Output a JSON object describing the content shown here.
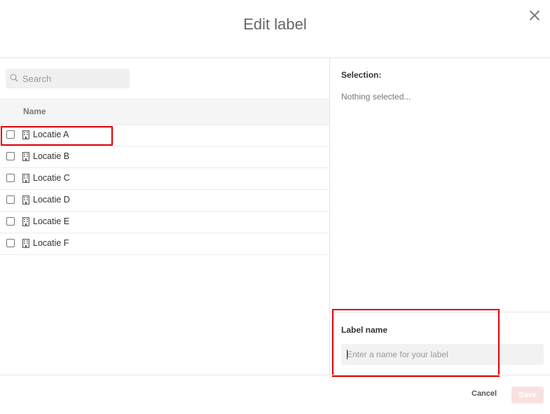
{
  "dialog": {
    "title": "Edit label"
  },
  "search": {
    "placeholder": "Search"
  },
  "table": {
    "header": "Name",
    "rows": [
      {
        "label": "Locatie A"
      },
      {
        "label": "Locatie B"
      },
      {
        "label": "Locatie C"
      },
      {
        "label": "Locatie D"
      },
      {
        "label": "Locatie E"
      },
      {
        "label": "Locatie F"
      }
    ]
  },
  "selection": {
    "title": "Selection:",
    "empty_text": "Nothing selected..."
  },
  "label_name": {
    "title": "Label name",
    "placeholder": "Enter a name for your label",
    "value": ""
  },
  "footer": {
    "cancel_label": "Cancel",
    "save_label": "Save"
  },
  "colors": {
    "highlight": "#e00000",
    "save_disabled": "#fae1e1"
  },
  "icons": {
    "close": "close-icon",
    "search": "search-icon",
    "row": "building-icon"
  }
}
